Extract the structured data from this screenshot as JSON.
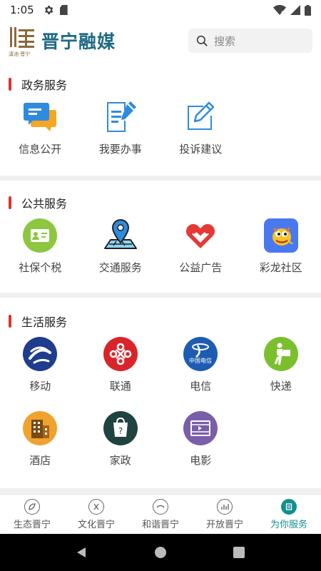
{
  "status_bar": {
    "time": "1:05"
  },
  "header": {
    "logo_title": "晋宁融媒",
    "logo_subtitle": "滇池·晋宁",
    "search_placeholder": "搜索"
  },
  "sections": [
    {
      "title": "政务服务",
      "items": [
        {
          "label": "信息公开",
          "icon": "chat-bubbles-icon"
        },
        {
          "label": "我要办事",
          "icon": "document-pin-icon"
        },
        {
          "label": "投诉建议",
          "icon": "edit-icon"
        }
      ]
    },
    {
      "title": "公共服务",
      "items": [
        {
          "label": "社保个税",
          "icon": "id-card-icon"
        },
        {
          "label": "交通服务",
          "icon": "map-pin-icon"
        },
        {
          "label": "公益广告",
          "icon": "heart-hands-icon"
        },
        {
          "label": "彩龙社区",
          "icon": "dragon-icon"
        }
      ]
    },
    {
      "title": "生活服务",
      "items": [
        {
          "label": "移动",
          "icon": "china-mobile-icon"
        },
        {
          "label": "联通",
          "icon": "china-unicom-icon"
        },
        {
          "label": "电信",
          "icon": "china-telecom-icon"
        },
        {
          "label": "快递",
          "icon": "courier-icon"
        },
        {
          "label": "酒店",
          "icon": "hotel-icon"
        },
        {
          "label": "家政",
          "icon": "housekeeping-icon"
        },
        {
          "label": "电影",
          "icon": "movie-icon"
        }
      ]
    }
  ],
  "telecom_logo_text": "中国电信",
  "bottom_nav": [
    {
      "label": "生态晋宁",
      "active": false
    },
    {
      "label": "文化晋宁",
      "active": false
    },
    {
      "label": "和谐晋宁",
      "active": false
    },
    {
      "label": "开放晋宁",
      "active": false
    },
    {
      "label": "为你服务",
      "active": true
    }
  ],
  "colors": {
    "accent": "#148e8e",
    "section_bar": "#e0312e",
    "logo": "#1e6a85"
  }
}
